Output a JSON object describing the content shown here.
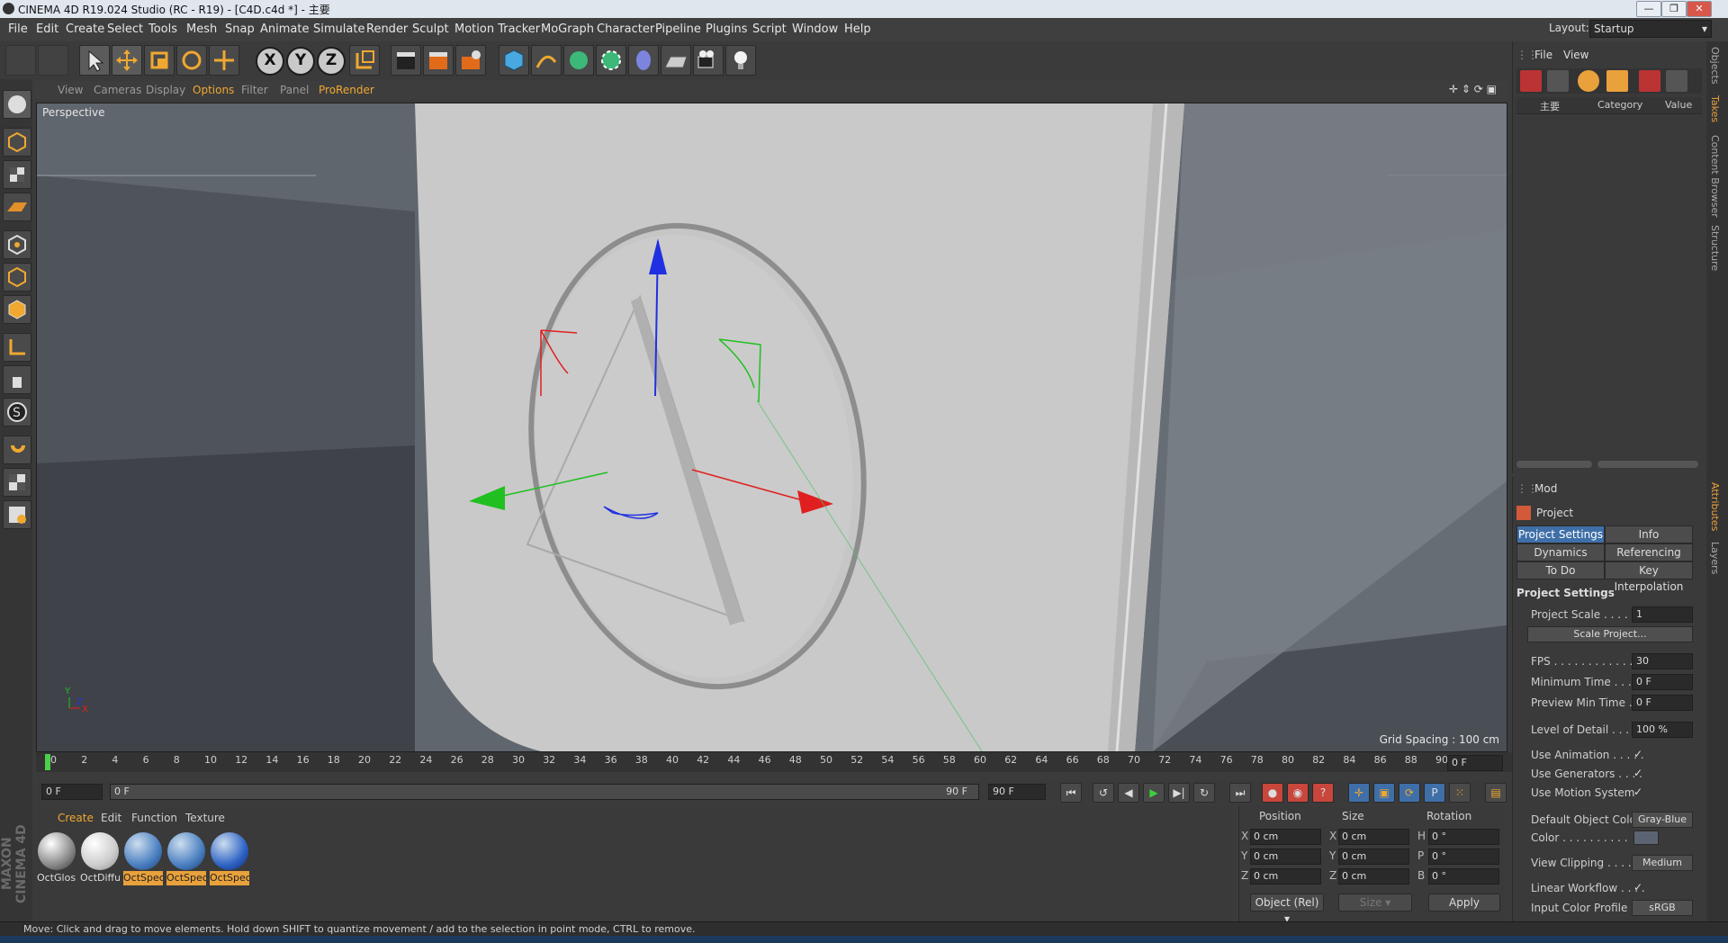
{
  "window": {
    "title": "CINEMA 4D R19.024 Studio (RC - R19) - [C4D.c4d *] - 主要",
    "buttons": [
      "—",
      "❐",
      "✕"
    ]
  },
  "menu": {
    "items": [
      "File",
      "Edit",
      "Create",
      "Select",
      "Tools",
      "Mesh",
      "Snap",
      "Animate",
      "Simulate",
      "Render",
      "Sculpt",
      "Motion Tracker",
      "MoGraph",
      "Character",
      "Pipeline",
      "Plugins",
      "Script",
      "Window",
      "Help"
    ],
    "layout_label": "Layout:",
    "layout_value": "Startup"
  },
  "toolbar": {
    "axis_x": "X",
    "axis_y": "Y",
    "axis_z": "Z"
  },
  "viewport_menu": {
    "items": [
      "View",
      "Cameras",
      "Display",
      "Options",
      "Filter",
      "Panel",
      "ProRender"
    ]
  },
  "viewport": {
    "camera_label": "Perspective",
    "grid_spacing": "Grid Spacing : 100 cm"
  },
  "timeline": {
    "ticks": [
      "0",
      "2",
      "4",
      "6",
      "8",
      "10",
      "12",
      "14",
      "16",
      "18",
      "20",
      "22",
      "24",
      "26",
      "28",
      "30",
      "32",
      "34",
      "36",
      "38",
      "40",
      "42",
      "44",
      "46",
      "48",
      "50",
      "52",
      "54",
      "56",
      "58",
      "60",
      "62",
      "64",
      "66",
      "68",
      "70",
      "72",
      "74",
      "76",
      "78",
      "80",
      "82",
      "84",
      "86",
      "88",
      "90"
    ],
    "current_frame": "0 F",
    "start_field": "0 F",
    "range_start": "0 F",
    "range_end": "90 F",
    "end_field": "90 F"
  },
  "materials": {
    "menu": [
      "Create",
      "Edit",
      "Function",
      "Texture"
    ],
    "items": [
      {
        "name": "OctGlos",
        "selected": false
      },
      {
        "name": "OctDiffu",
        "selected": false
      },
      {
        "name": "OctSpec",
        "selected": true
      },
      {
        "name": "OctSpec",
        "selected": true
      },
      {
        "name": "OctSpec",
        "selected": true
      }
    ]
  },
  "coords": {
    "headers": {
      "position": "Position",
      "size": "Size",
      "rotation": "Rotation"
    },
    "rows": [
      {
        "axis": "X",
        "pos": "0 cm",
        "size_axis": "X",
        "size": "0 cm",
        "rot_axis": "H",
        "rot": "0 °"
      },
      {
        "axis": "Y",
        "pos": "0 cm",
        "size_axis": "Y",
        "size": "0 cm",
        "rot_axis": "P",
        "rot": "0 °"
      },
      {
        "axis": "Z",
        "pos": "0 cm",
        "size_axis": "Z",
        "size": "0 cm",
        "rot_axis": "B",
        "rot": "0 °"
      }
    ],
    "mode": "Object (Rel)",
    "size_mode": "Size",
    "apply": "Apply"
  },
  "object_manager": {
    "menu": [
      "File",
      "View"
    ],
    "column_name": "主要",
    "column_category": "Category",
    "column_value": "Value"
  },
  "attributes": {
    "mode": "Mod",
    "title": "Project",
    "tabs": [
      "Project Settings",
      "Info",
      "Dynamics",
      "Referencing",
      "To Do",
      "Key Interpolation"
    ],
    "section": "Project Settings",
    "props": {
      "project_scale_label": "Project Scale . . . . . .",
      "project_scale": "1",
      "scale_project_btn": "Scale Project...",
      "fps_label": "FPS . . . . . . . . . . . . . .",
      "fps": "30",
      "min_time_label": "Minimum Time . . . . .",
      "min_time": "0 F",
      "preview_min_label": "Preview Min Time . . .",
      "preview_min": "0 F",
      "lod_label": "Level of Detail . . . . .",
      "lod": "100 %",
      "use_anim_label": "Use Animation . . . . .",
      "use_gen_label": "Use Generators . . . .",
      "use_motion_label": "Use Motion System",
      "def_color_label": "Default Object Color",
      "def_color": "Gray-Blue",
      "color_label": "Color . . . . . . . . . .",
      "view_clip_label": "View Clipping . . . . .",
      "view_clip": "Medium",
      "linear_label": "Linear Workflow . . . .",
      "input_color_label": "Input Color Profile . .",
      "input_color": "sRGB"
    }
  },
  "right_tabs": [
    "Objects",
    "Takes",
    "Content Browser",
    "Structure",
    "Attributes",
    "Layers"
  ],
  "status": "Move: Click and drag to move elements. Hold down SHIFT to quantize movement / add to the selection in point mode, CTRL to remove.",
  "brand": "MAXON CINEMA 4D",
  "colors": {
    "accent_orange": "#e9a13b",
    "selection_blue": "#3f6fa8",
    "gizmo_red": "#e02020",
    "gizmo_green": "#20c020",
    "gizmo_blue": "#2030e0"
  }
}
